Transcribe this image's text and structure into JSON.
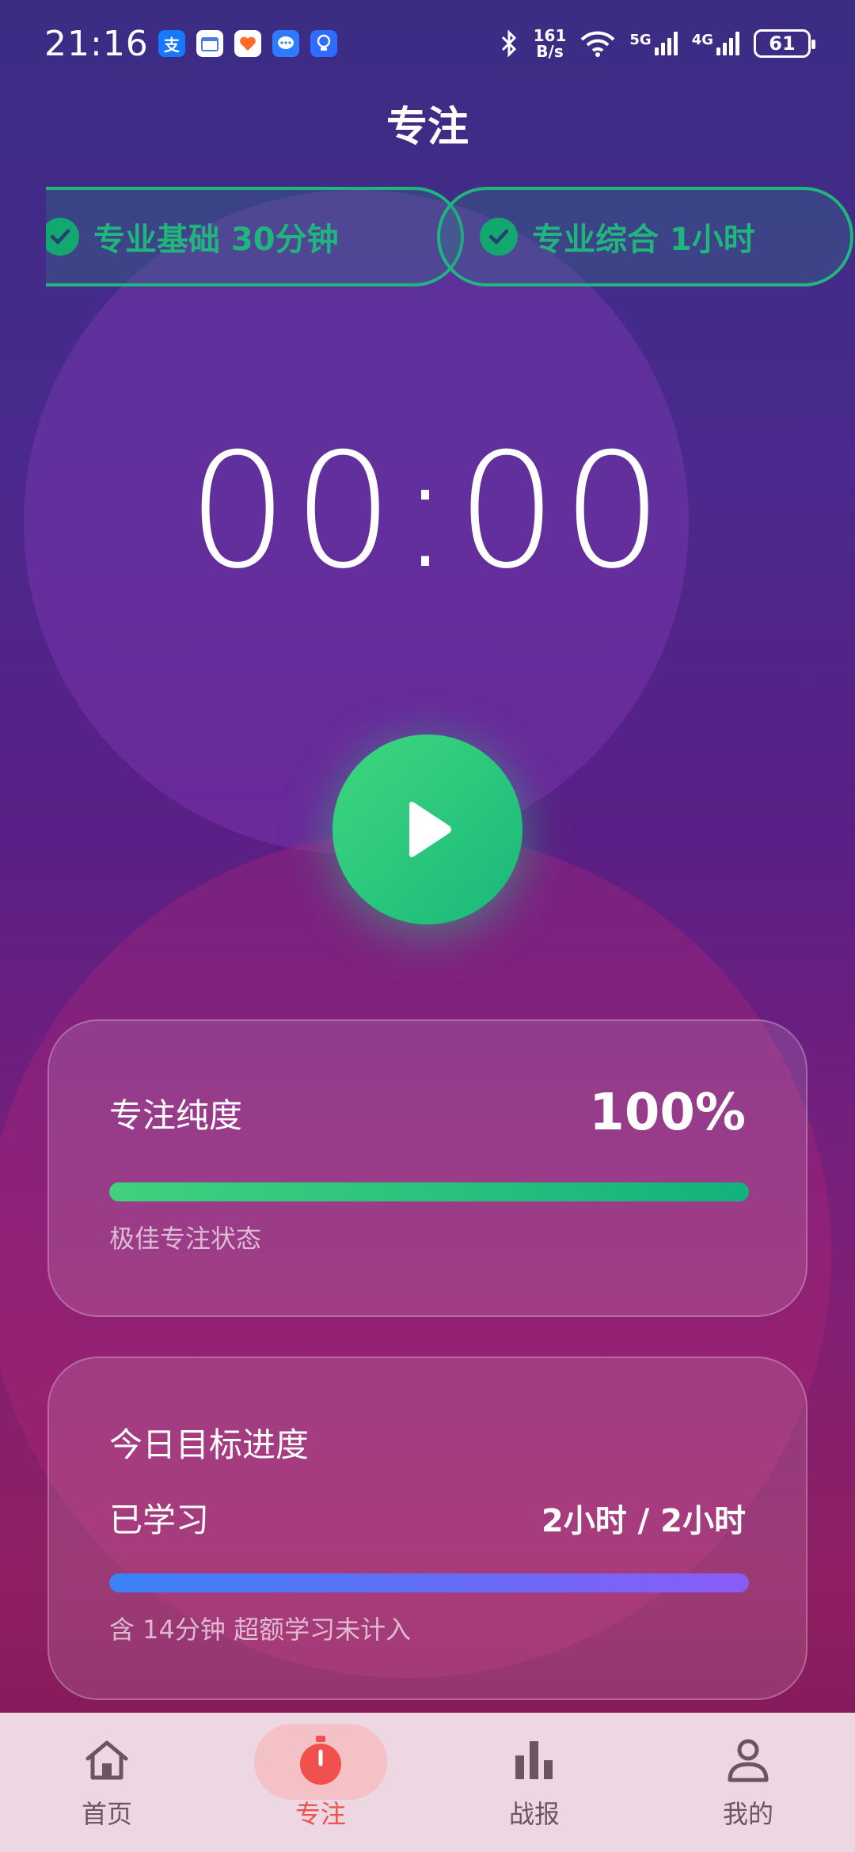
{
  "status_bar": {
    "time": "21:16",
    "net_speed_value": "161",
    "net_speed_unit": "B/s",
    "signal_5g": "5G",
    "signal_4g": "4G",
    "battery": "61"
  },
  "title": "专注",
  "tags": [
    {
      "label": "专业基础 30分钟"
    },
    {
      "label": "专业综合 1小时"
    }
  ],
  "timer": "00:00",
  "focus_card": {
    "label": "专注纯度",
    "value": "100%",
    "progress": 1.0,
    "status": "极佳专注状态"
  },
  "goal_card": {
    "title": "今日目标进度",
    "studied_label": "已学习",
    "studied_value": "2小时 / 2小时",
    "progress": 1.0,
    "note": "含 14分钟 超额学习未计入"
  },
  "tabbar": [
    {
      "label": "首页",
      "icon": "home-icon",
      "active": false
    },
    {
      "label": "专注",
      "icon": "stopwatch-icon",
      "active": true
    },
    {
      "label": "战报",
      "icon": "bar-chart-icon",
      "active": false
    },
    {
      "label": "我的",
      "icon": "person-icon",
      "active": false
    }
  ],
  "colors": {
    "accent_green": "#1fb57c",
    "active_tab": "#f0514f"
  }
}
